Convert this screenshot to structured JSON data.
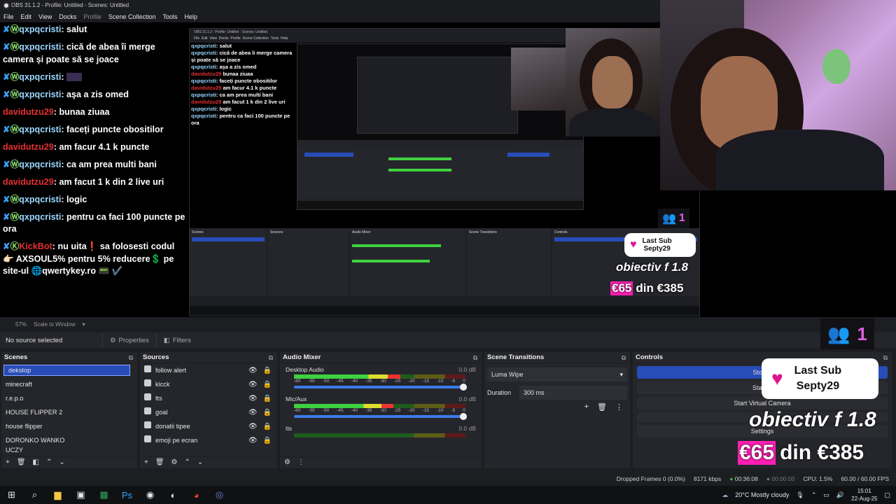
{
  "window": {
    "title": "OBS 31.1.2 - Profile: Untitled - Scenes: Untitled"
  },
  "menu": [
    {
      "label": "File"
    },
    {
      "label": "Edit"
    },
    {
      "label": "View"
    },
    {
      "label": "Docks"
    },
    {
      "label": "Profile"
    },
    {
      "label": "Scene Collection"
    },
    {
      "label": "Tools"
    },
    {
      "label": "Help"
    }
  ],
  "chat": [
    {
      "user": "qxpqcristi",
      "text": "salut"
    },
    {
      "user": "qxpqcristi",
      "text": "cică de abea îi merge camera și poate să se joace"
    },
    {
      "user": "qxpqcristi",
      "text": ""
    },
    {
      "user": "qxpqcristi",
      "text": "aşa a zis omed"
    },
    {
      "user": "davidutzu29",
      "text": "bunaa ziuaa"
    },
    {
      "user": "qxpqcristi",
      "text": "faceți puncte obositilor"
    },
    {
      "user": "davidutzu29",
      "text": "am facur 4.1 k puncte"
    },
    {
      "user": "qxpqcristi",
      "text": "ca am prea multi bani"
    },
    {
      "user": "davidutzu29",
      "text": "am facut 1 k din 2 live uri"
    },
    {
      "user": "qxpqcristi",
      "text": "logic"
    },
    {
      "user": "qxpqcristi",
      "text": "pentru ca faci 100 puncte pe ora"
    },
    {
      "user": "KickBot",
      "text": "nu uita❗ sa folosesti codul 👉🏻 AXSOUL5% pentru 5% reducere💲 pe site-ul 🌐qwertykey.ro 📟 ✔️"
    }
  ],
  "overlay": {
    "viewers": "1",
    "last_sub_title": "Last Sub",
    "last_sub_name": "Septy29",
    "objective": "obiectiv f 1.8",
    "goal_current": "€65",
    "goal_rest": "din €385"
  },
  "preview_bar": {
    "zoom": "57%",
    "scale_mode": "Scale to Window"
  },
  "source_toolbar": {
    "no_source": "No source selected",
    "properties": "Properties",
    "filters": "Filters"
  },
  "scenes": {
    "title": "Scenes",
    "items": [
      "dekstop",
      "minecraft",
      "r.e.p.o",
      "HOUSE FLIPPER 2",
      "house flipper",
      "DORONKO WANKO",
      "UCZY"
    ]
  },
  "sources": {
    "title": "Sources",
    "items": [
      "follow alert",
      "kicck",
      "tts",
      "goal",
      "donatii tipee",
      "emoji pe ecran",
      "..."
    ]
  },
  "mixer": {
    "title": "Audio Mixer",
    "channels": [
      {
        "name": "Desktop Audio",
        "db": "0.0 dB",
        "level": 0.62
      },
      {
        "name": "Mic/Aux",
        "db": "0.0 dB",
        "level": 0.58
      },
      {
        "name": "tts",
        "db": "0.0 dB",
        "level": 0.0
      }
    ],
    "scale": [
      "-60",
      "-55",
      "-50",
      "-45",
      "-40",
      "-35",
      "-30",
      "-25",
      "-20",
      "-15",
      "-10",
      "-5",
      "0"
    ]
  },
  "transitions": {
    "title": "Scene Transitions",
    "selected": "Luma Wipe",
    "duration_label": "Duration",
    "duration": "300 ms"
  },
  "controls": {
    "title": "Controls",
    "stop_streaming": "Stop S",
    "start_recording": "Start R",
    "virtual_camera": "Start Virtual Camera",
    "settings": "Settings"
  },
  "status": {
    "dropped": "Dropped Frames 0 (0.0%)",
    "bitrate": "8171 kbps",
    "stream_time": "00:36:08",
    "rec_time": "00:00:00",
    "cpu": "CPU: 1.5%",
    "fps": "60.00 / 60.00 FPS"
  },
  "taskbar": {
    "weather": "20°C  Mostly cloudy",
    "time": "15:01",
    "date": "22-Aug-25"
  }
}
